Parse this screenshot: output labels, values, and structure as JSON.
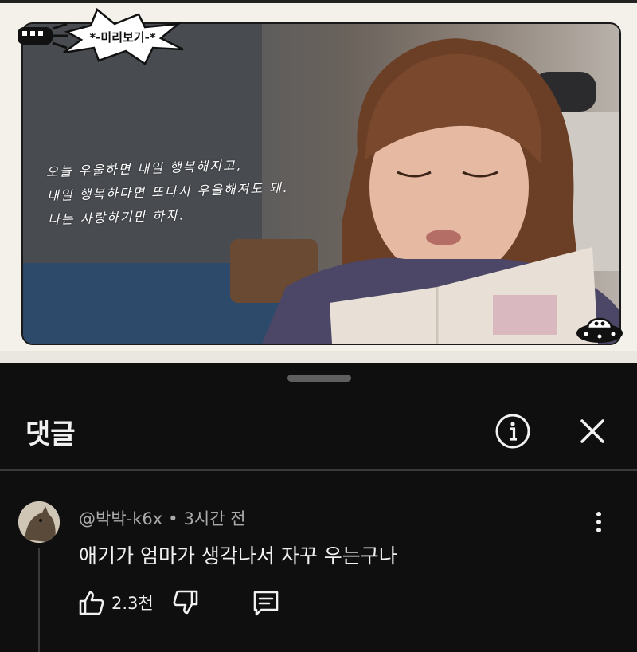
{
  "video": {
    "badge_text": "*-미리보기-*",
    "handwriting_lines": [
      "오늘 우울하면 내일 행복해지고,",
      "내일 행복하다면 또다시 우울해져도 돼.",
      "나는 사랑하기만 하자."
    ]
  },
  "sheet": {
    "title": "댓글"
  },
  "comment": {
    "author": "@박박-k6x",
    "separator": "•",
    "time": "3시간 전",
    "text": "애기가 엄마가 생각나서 자꾸 우는구나",
    "like_count": "2.3천"
  },
  "icons": {
    "info": "info-icon",
    "close": "close-icon",
    "more": "more-vert-icon",
    "like": "thumb-up-icon",
    "dislike": "thumb-down-icon",
    "reply": "reply-comment-icon"
  },
  "colors": {
    "background": "#0f0f0f",
    "text_primary": "#f1f1f1",
    "text_secondary": "#aaaaaa",
    "divider": "#3a3a3a"
  }
}
